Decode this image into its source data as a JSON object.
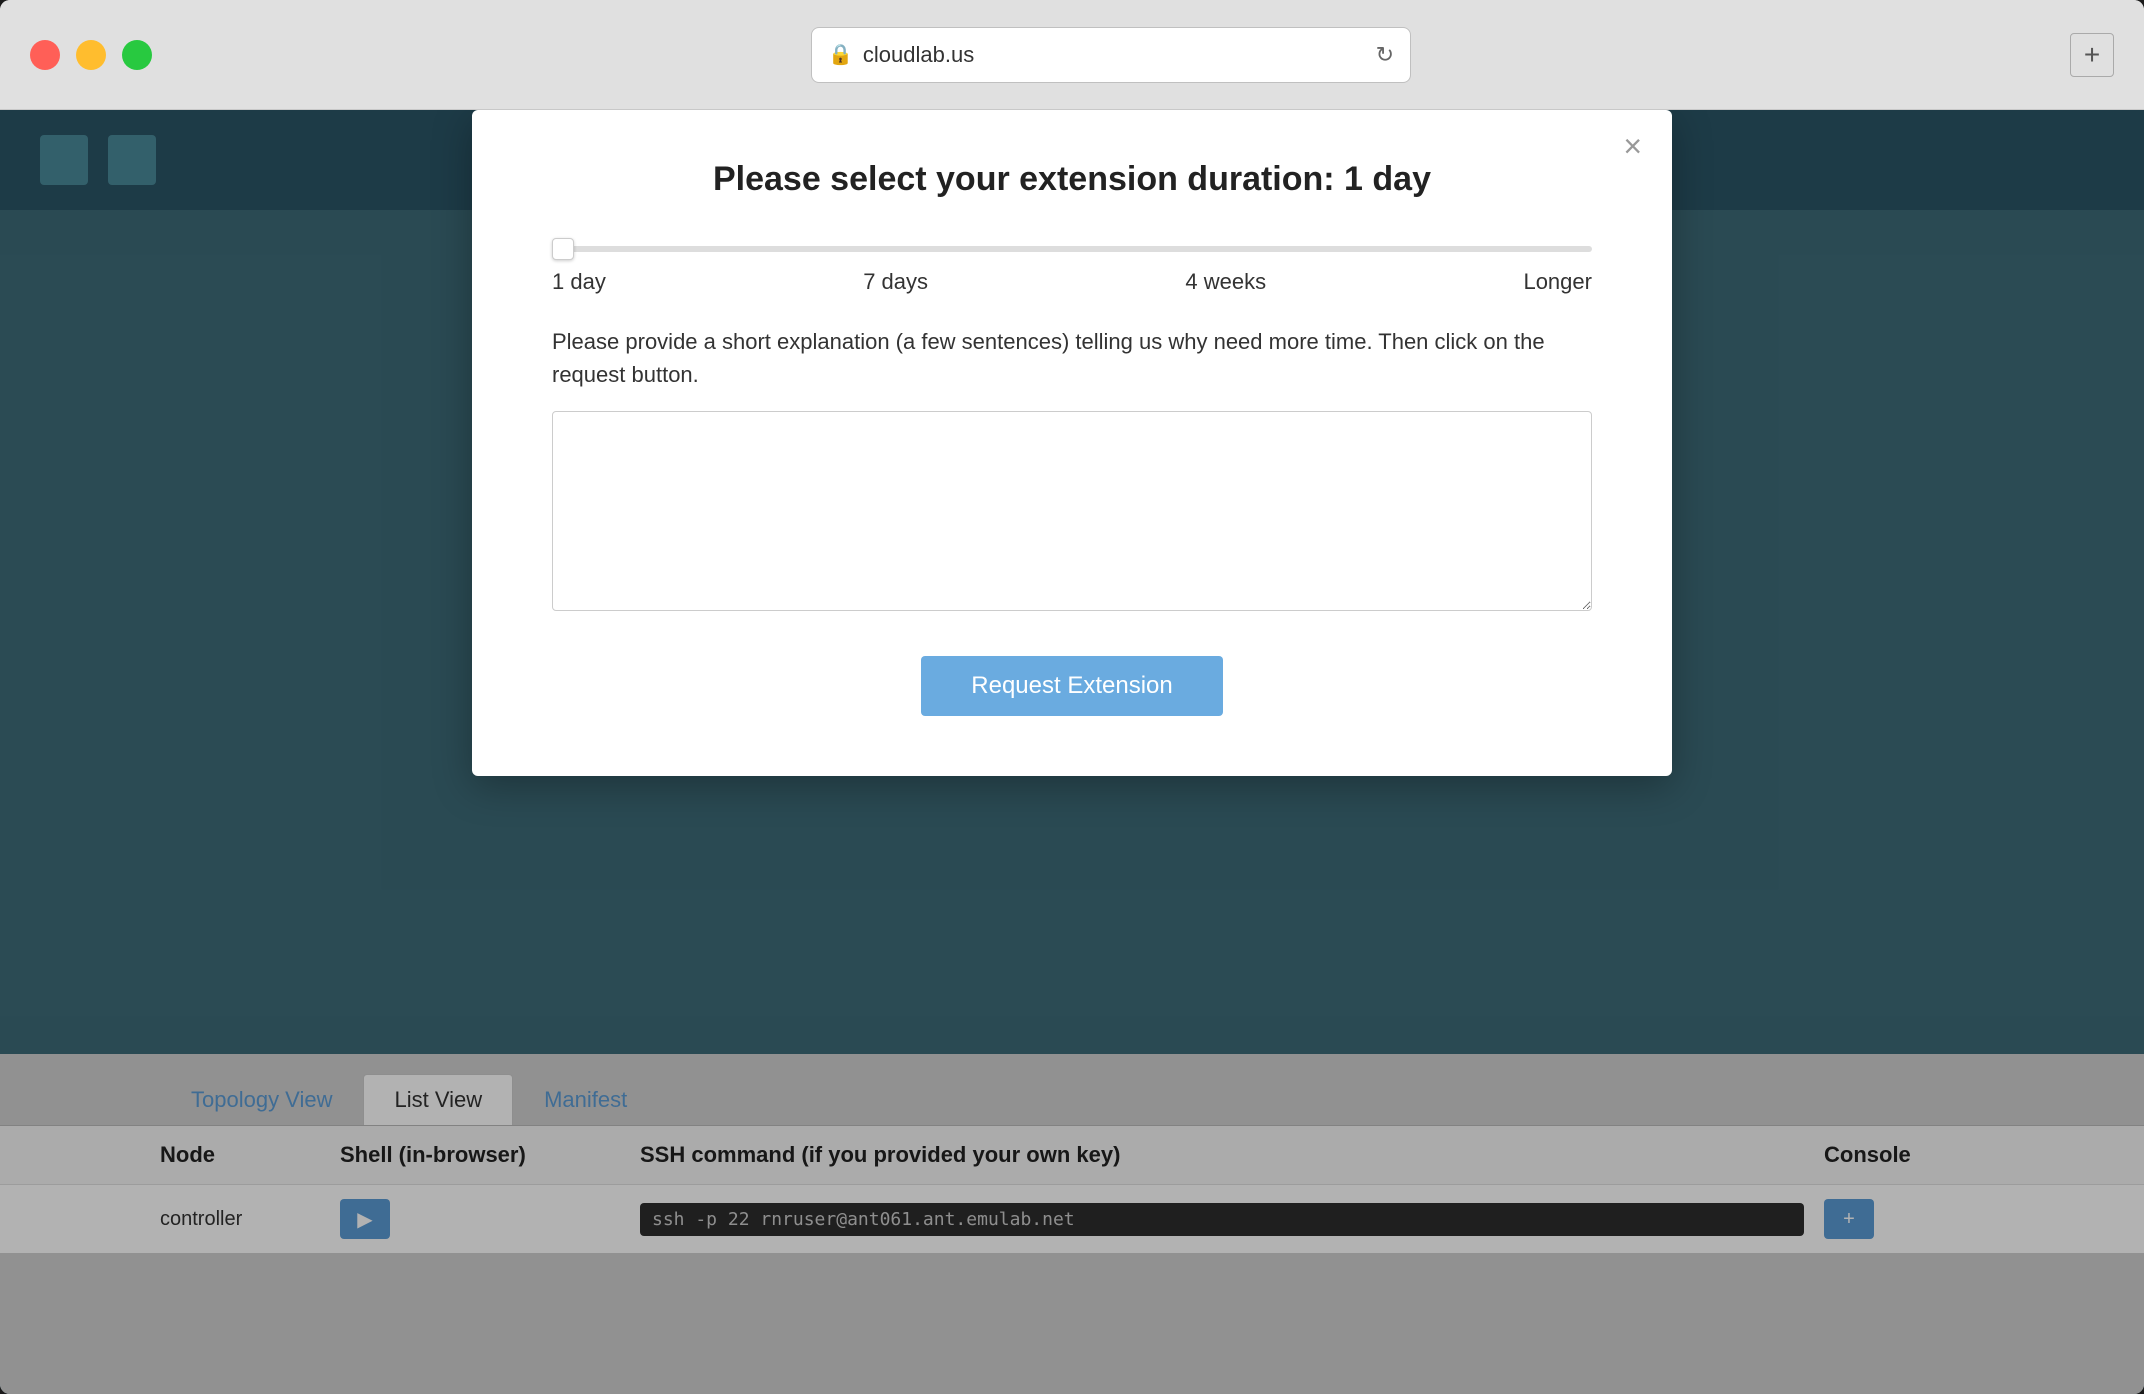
{
  "browser": {
    "url": "cloudlab.us",
    "new_tab_label": "+"
  },
  "modal": {
    "title": "Please select your extension duration: 1 day",
    "close_label": "×",
    "slider": {
      "min": 0,
      "max": 100,
      "value": 0,
      "labels": [
        "1 day",
        "7 days",
        "4 weeks",
        "Longer"
      ]
    },
    "explanation_prompt": "Please provide a short explanation (a few sentences) telling us why need more time. Then click on the request button.",
    "textarea_placeholder": "",
    "submit_label": "Request Extension"
  },
  "tabs": [
    {
      "label": "Topology View",
      "active": false
    },
    {
      "label": "List View",
      "active": true
    },
    {
      "label": "Manifest",
      "active": false
    }
  ],
  "table": {
    "headers": {
      "node": "Node",
      "shell": "Shell (in-browser)",
      "ssh": "SSH command (if you provided your own key)",
      "console": "Console"
    },
    "rows": [
      {
        "node": "controller",
        "shell_btn": "▶",
        "ssh": "ssh -p 22 rnruser@ant061.ant.emulab.net",
        "console_btn": "+"
      }
    ]
  },
  "app_bar": {
    "btn1_label": "",
    "btn2_label": ""
  }
}
